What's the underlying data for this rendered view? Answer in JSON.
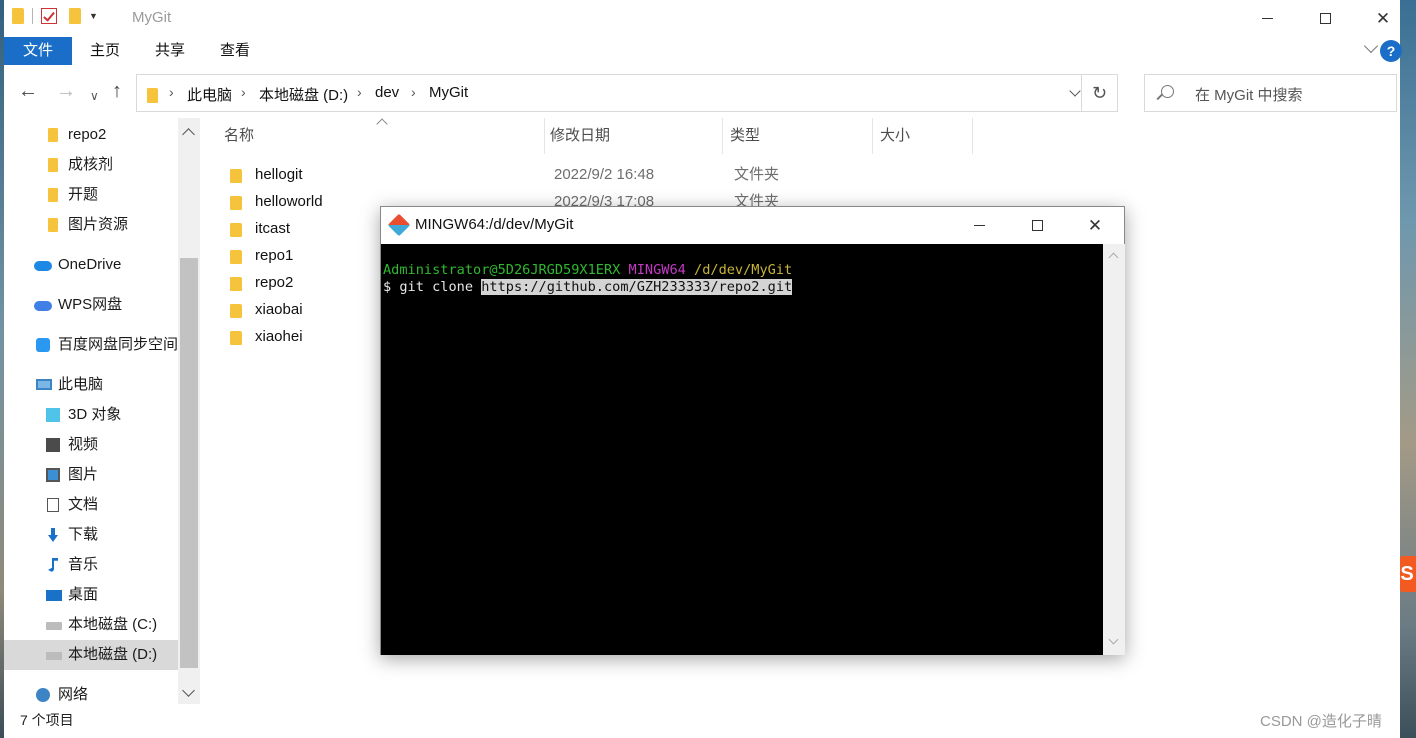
{
  "explorer": {
    "title": "MyGit",
    "ribbon_tabs": [
      "文件",
      "主页",
      "共享",
      "查看"
    ],
    "breadcrumb": [
      "此电脑",
      "本地磁盘 (D:)",
      "dev",
      "MyGit"
    ],
    "search_placeholder": "在 MyGit 中搜索",
    "nav_items": [
      {
        "label": "repo2",
        "icon": "folder-icon"
      },
      {
        "label": "成核剂",
        "icon": "folder-icon"
      },
      {
        "label": "开题",
        "icon": "folder-icon"
      },
      {
        "label": "图片资源",
        "icon": "folder-icon"
      },
      {
        "label": "OneDrive",
        "icon": "onedrive-cloud-icon"
      },
      {
        "label": "WPS网盘",
        "icon": "wps-cloud-icon"
      },
      {
        "label": "百度网盘同步空间",
        "icon": "baidu-netdisk-icon"
      },
      {
        "label": "此电脑",
        "icon": "this-pc-icon"
      },
      {
        "label": "3D 对象",
        "icon": "3d-objects-icon"
      },
      {
        "label": "视频",
        "icon": "video-icon"
      },
      {
        "label": "图片",
        "icon": "pictures-icon"
      },
      {
        "label": "文档",
        "icon": "documents-icon"
      },
      {
        "label": "下载",
        "icon": "download-icon"
      },
      {
        "label": "音乐",
        "icon": "music-icon"
      },
      {
        "label": "桌面",
        "icon": "desktop-icon"
      },
      {
        "label": "本地磁盘 (C:)",
        "icon": "drive-icon"
      },
      {
        "label": "本地磁盘 (D:)",
        "icon": "drive-icon",
        "selected": true
      },
      {
        "label": "网络",
        "icon": "network-icon"
      }
    ],
    "columns": [
      "名称",
      "修改日期",
      "类型",
      "大小"
    ],
    "files": [
      {
        "name": "hellogit",
        "date": "2022/9/2 16:48",
        "type": "文件夹"
      },
      {
        "name": "helloworld",
        "date": "2022/9/3 17:08",
        "type": "文件夹"
      },
      {
        "name": "itcast",
        "date": "",
        "type": ""
      },
      {
        "name": "repo1",
        "date": "",
        "type": ""
      },
      {
        "name": "repo2",
        "date": "",
        "type": ""
      },
      {
        "name": "xiaobai",
        "date": "",
        "type": ""
      },
      {
        "name": "xiaohei",
        "date": "",
        "type": ""
      }
    ],
    "status": "7 个项目"
  },
  "terminal": {
    "title": "MINGW64:/d/dev/MyGit",
    "prompt_user": "Administrator@5D26JRGD59X1ERX",
    "prompt_host": "MINGW64",
    "prompt_path": "/d/dev/MyGit",
    "command_prefix": "$ git clone ",
    "command_selected": "https://github.com/GZH233333/repo2.git"
  },
  "watermark": "CSDN @造化子晴",
  "colors": {
    "ribbon_file_tab": "#1a6ec7",
    "terminal_bg": "#000000",
    "prompt_user": "#2fb82f",
    "prompt_host": "#c339c3",
    "prompt_path": "#c8b43a"
  }
}
